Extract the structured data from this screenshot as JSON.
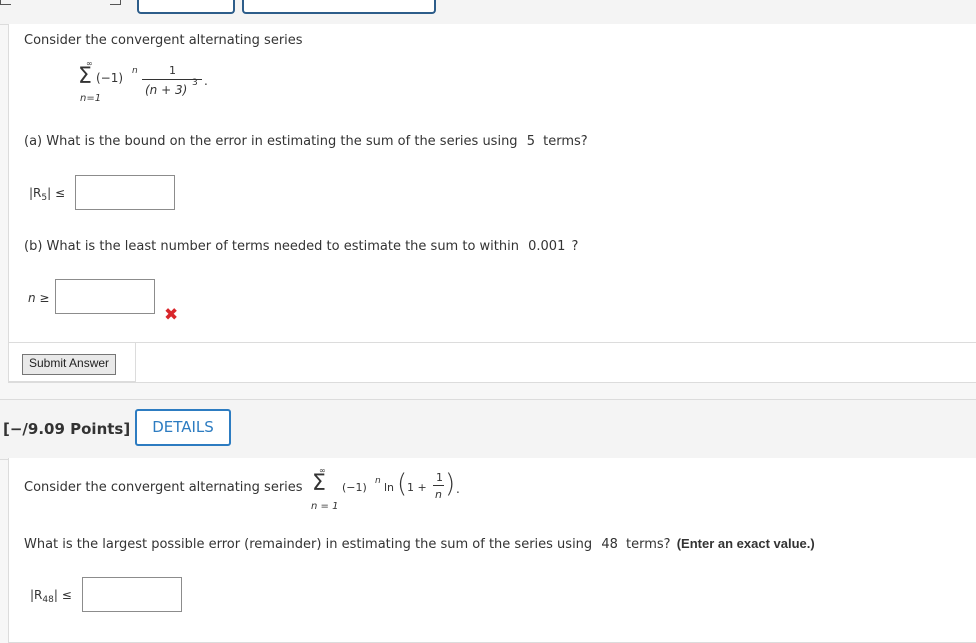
{
  "q1": {
    "intro": "Consider the convergent alternating series",
    "series": {
      "sigma": "Σ",
      "upper": "∞",
      "lower": "n=1",
      "term": "(−1)",
      "exp": "n",
      "numerator": "1",
      "denominator": "(n + 3)",
      "den_exp": "3",
      "end": "."
    },
    "part_a": {
      "text": "(a) What is the bound on the error in estimating the sum of the series using",
      "value": "5",
      "suffix": "terms?",
      "label_R": "|R",
      "label_sub": "5",
      "label_end": "| ≤",
      "input_value": ""
    },
    "part_b": {
      "text": "(b) What is the least number of terms needed to estimate the sum to within",
      "value": "0.001",
      "suffix": "?",
      "label": "n ≥",
      "input_value": "",
      "status_icon": "✖"
    },
    "submit_label": "Submit Answer"
  },
  "q2": {
    "points": "[−/9.09 Points]",
    "details_label": "DETAILS",
    "intro": "Consider the convergent alternating series",
    "series": {
      "sigma": "Σ",
      "upper": "∞",
      "lower": "n = 1",
      "term": "(−1)",
      "exp": "n",
      "ln": "ln",
      "one_plus": "1 +",
      "numerator": "1",
      "denominator": "n",
      "end": "."
    },
    "question_text": "What is the largest possible error (remainder) in estimating the sum of the series using",
    "value": "48",
    "suffix": "terms?",
    "bold_note": "(Enter an exact value.)",
    "label_R": "|R",
    "label_sub": "48",
    "label_end": "| ≤",
    "input_value": ""
  },
  "colors": {
    "accent_blue": "#2d7cc1",
    "error_red": "#d9262b"
  }
}
